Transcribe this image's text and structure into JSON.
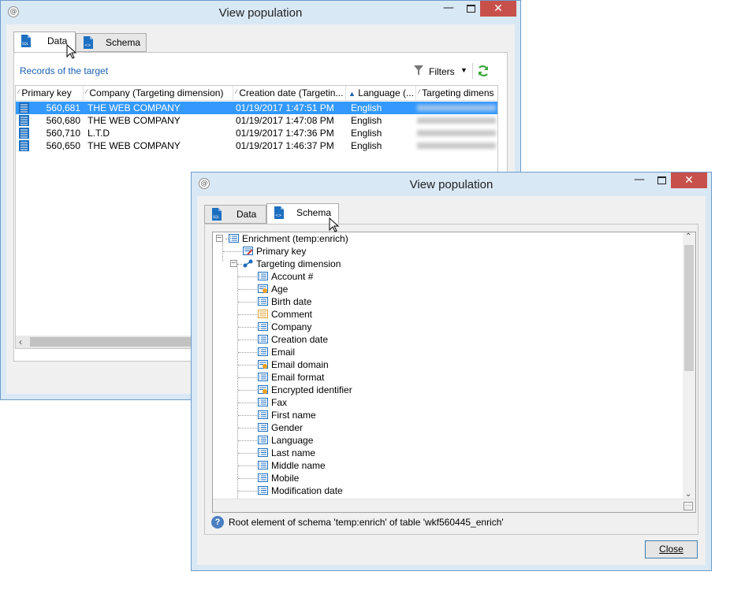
{
  "window1": {
    "title": "View population",
    "tabs": [
      {
        "label": "Data"
      },
      {
        "label": "Schema"
      }
    ],
    "records_link": "Records of the target",
    "filters_label": "Filters",
    "columns": [
      "Primary key",
      "Company (Targeting dimension)",
      "Creation date (Targetin...",
      "Language (...",
      "Targeting dimens"
    ],
    "rows": [
      {
        "key": "560,681",
        "company": "THE WEB COMPANY",
        "date": "01/19/2017 1:47:51 PM",
        "language": "English"
      },
      {
        "key": "560,680",
        "company": "THE WEB COMPANY",
        "date": "01/19/2017 1:47:08 PM",
        "language": "English"
      },
      {
        "key": "560,710",
        "company": "L.T.D",
        "date": "01/19/2017 1:47:36 PM",
        "language": "English"
      },
      {
        "key": "560,650",
        "company": "THE WEB COMPANY",
        "date": "01/19/2017 1:46:37 PM",
        "language": "English"
      }
    ]
  },
  "window2": {
    "title": "View population",
    "tabs": [
      {
        "label": "Data"
      },
      {
        "label": "Schema"
      }
    ],
    "tree": {
      "root": "Enrichment (temp:enrich)",
      "primary_key": "Primary key",
      "targeting": "Targeting dimension",
      "fields": [
        {
          "label": "Account #",
          "icon": "field-icon"
        },
        {
          "label": "Age",
          "icon": "computed-field-icon"
        },
        {
          "label": "Birth date",
          "icon": "field-icon"
        },
        {
          "label": "Comment",
          "icon": "memo-field-icon"
        },
        {
          "label": "Company",
          "icon": "field-icon"
        },
        {
          "label": "Creation date",
          "icon": "field-icon"
        },
        {
          "label": "Email",
          "icon": "field-icon"
        },
        {
          "label": "Email domain",
          "icon": "computed-field-icon"
        },
        {
          "label": "Email format",
          "icon": "field-icon"
        },
        {
          "label": "Encrypted identifier",
          "icon": "computed-field-icon"
        },
        {
          "label": "Fax",
          "icon": "field-icon"
        },
        {
          "label": "First name",
          "icon": "field-icon"
        },
        {
          "label": "Gender",
          "icon": "field-icon"
        },
        {
          "label": "Language",
          "icon": "field-icon"
        },
        {
          "label": "Last name",
          "icon": "field-icon"
        },
        {
          "label": "Middle name",
          "icon": "field-icon"
        },
        {
          "label": "Mobile",
          "icon": "field-icon"
        },
        {
          "label": "Modification date",
          "icon": "field-icon"
        }
      ]
    },
    "status_text": "Root element of schema 'temp:enrich' of table 'wkf560445_enrich'",
    "close_label": "Close"
  }
}
